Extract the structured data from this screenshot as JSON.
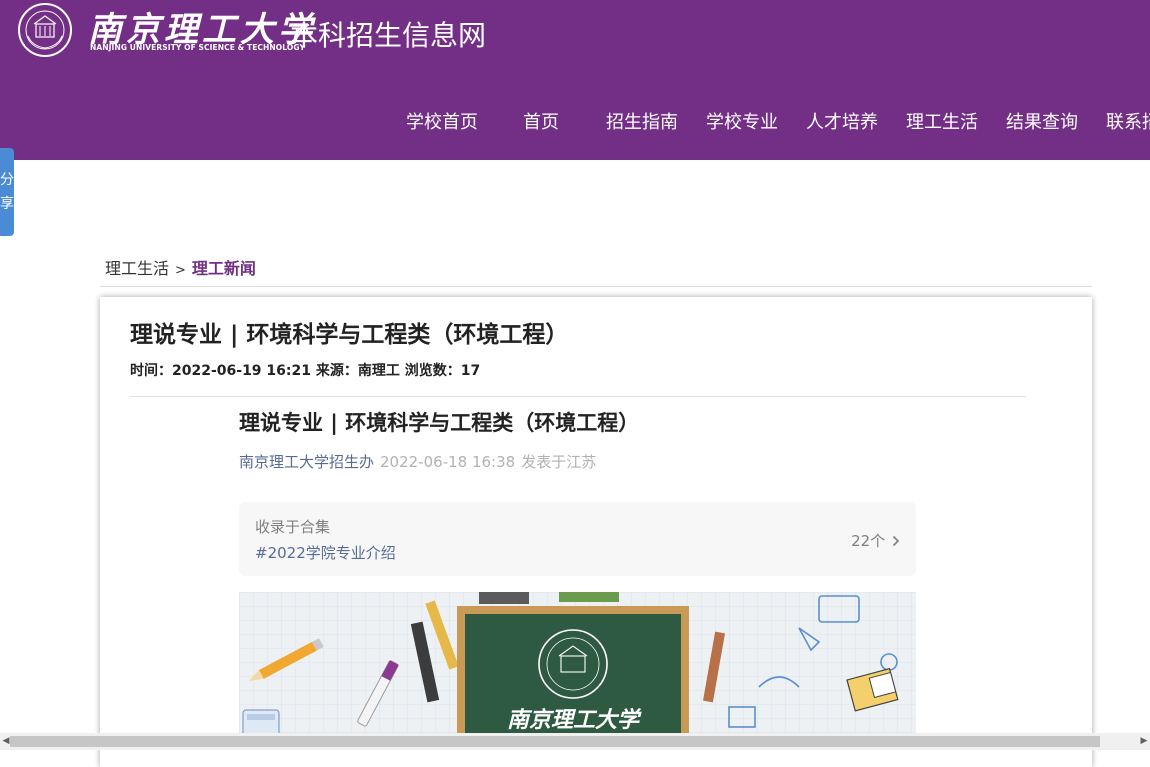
{
  "header": {
    "logo_cn": "南京理工大学",
    "logo_en": "NANJING UNIVERSITY OF SCIENCE & TECHNOLOGY",
    "site_name": "本科招生信息网",
    "bg_color": "#732f86"
  },
  "nav": {
    "items": [
      {
        "label": "学校首页"
      },
      {
        "label": "首页"
      },
      {
        "label": "招生指南"
      },
      {
        "label": "学校专业"
      },
      {
        "label": "人才培养"
      },
      {
        "label": "理工生活"
      },
      {
        "label": "结果查询"
      },
      {
        "label": "联系招"
      }
    ]
  },
  "share": {
    "line1": "分",
    "line2": "享"
  },
  "breadcrumb": {
    "parent": "理工生活",
    "separator": ">",
    "current": "理工新闻"
  },
  "article": {
    "title": "理说专业 | 环境科学与工程类（环境工程）",
    "meta": "时间：2022-06-19 16:21 来源：南理工 浏览数：17"
  },
  "wechat": {
    "title": "理说专业 | 环境科学与工程类（环境工程）",
    "author": "南京理工大学招生办",
    "date": "2022-06-18 16:38",
    "location": "发表于江苏",
    "collection_label": "收录于合集",
    "collection_tag": "#2022学院专业介绍",
    "collection_count": "22个",
    "collection_arrow": "chevron-right-icon"
  },
  "poster": {
    "board_text": "南京理工大学"
  },
  "scrollbar": {
    "left_arrow": "◀",
    "right_arrow": "▶"
  }
}
